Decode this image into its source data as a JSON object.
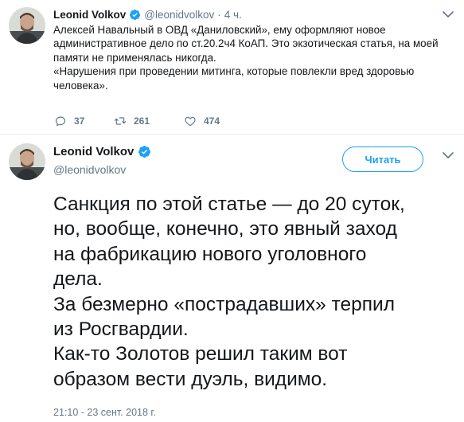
{
  "tweet1": {
    "name": "Leonid Volkov",
    "handle": "@leonidvolkov",
    "separator": "·",
    "time": "4 ч.",
    "text_lines": [
      "Алексей Навальный в ОВД «Даниловский», ему оформляют новое",
      "административное дело по ст.20.2ч4 КоАП. Это экзотическая статья, на моей",
      "памяти не применялась никогда.",
      "«Нарушения при проведении митинга, которые повлекли вред здоровью",
      "человека»."
    ],
    "replies": "37",
    "retweets": "261",
    "likes": "474"
  },
  "tweet2": {
    "name": "Leonid Volkov",
    "handle": "@leonidvolkov",
    "follow_label": "Читать",
    "text_lines": [
      "Санкция по этой статье — до 20 суток,",
      "но, вообще, конечно, это явный заход",
      "на фабрикацию нового уголовного",
      "дела.",
      "За безмерно «пострадавших» терпил",
      "из Росгвардии.",
      "Как-то Золотов решил таким вот",
      "образом вести дуэль, видимо."
    ],
    "timestamp": "21:10 - 23 сент. 2018 г."
  },
  "colors": {
    "accent": "#1da1f2",
    "secondary_text": "#657786",
    "primary_text": "#14171a"
  },
  "icons": [
    "avatar",
    "verified-badge-icon",
    "chevron-down-icon",
    "reply-icon",
    "retweet-icon",
    "like-icon"
  ]
}
